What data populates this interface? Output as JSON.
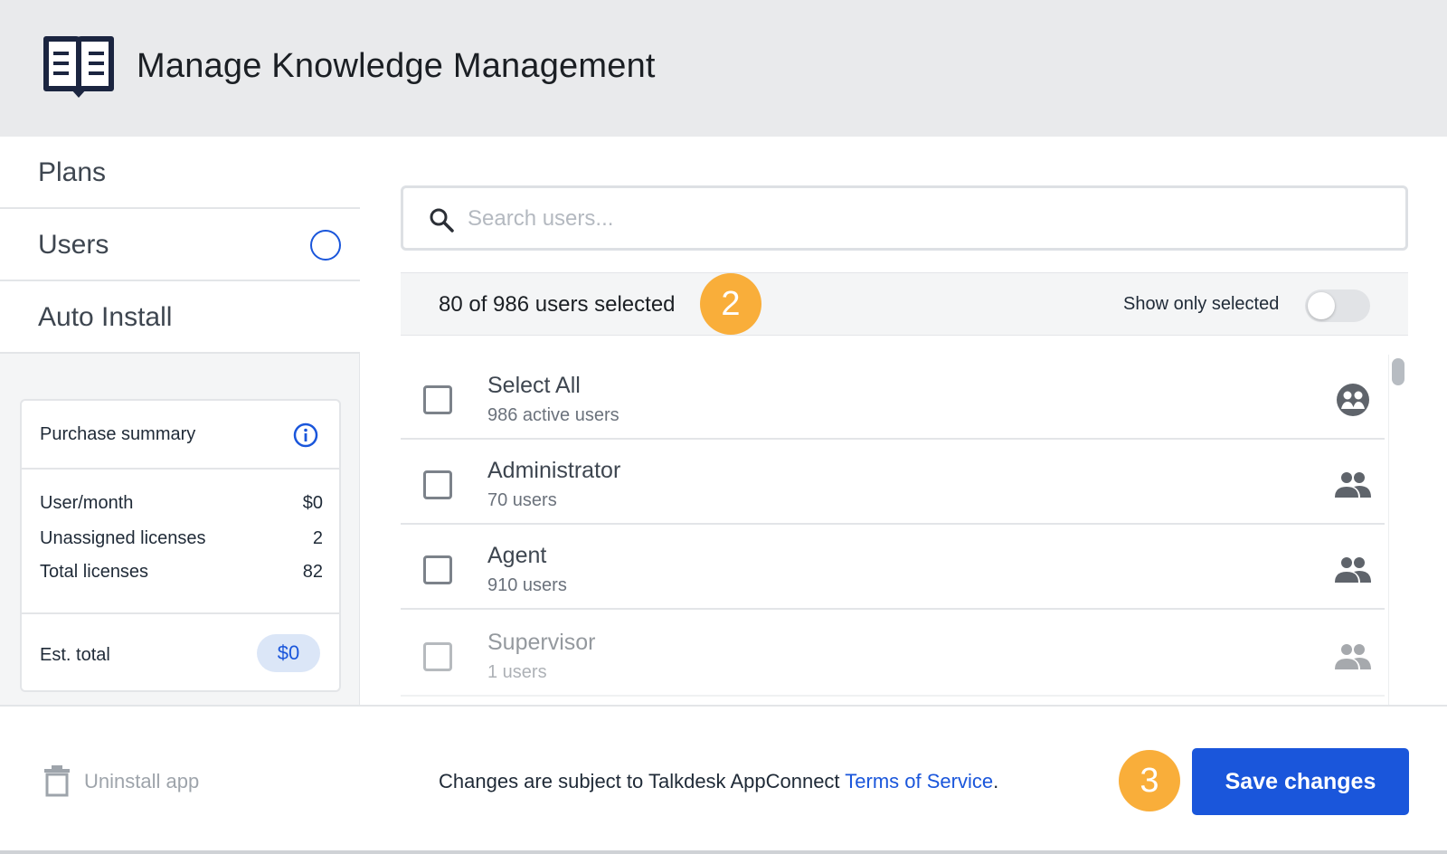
{
  "app": {
    "title": "Manage Knowledge Management",
    "icon": "book-icon"
  },
  "sidebar": {
    "items": [
      {
        "label": "Plans"
      },
      {
        "label": "Users",
        "indicator": "circle-icon"
      },
      {
        "label": "Auto Install"
      }
    ]
  },
  "purchase_summary": {
    "title": "Purchase summary",
    "rows": [
      {
        "label": "User/month",
        "value": "$0"
      },
      {
        "label": "Unassigned licenses",
        "value": "2"
      },
      {
        "label": "Total licenses",
        "value": "82"
      }
    ],
    "est_total_label": "Est. total",
    "est_total_value": "$0"
  },
  "search": {
    "placeholder": "Search users...",
    "value": ""
  },
  "selection": {
    "count_bold": "80",
    "count_rest": " of 986 users selected",
    "show_only_selected_label": "Show only selected",
    "show_only_selected": false
  },
  "badges": {
    "step2": "2",
    "step3": "3",
    "color": "#f9ae3a"
  },
  "list": [
    {
      "name": "Select All",
      "sub": "986 active users",
      "icon": "group-circle-icon",
      "checked": false
    },
    {
      "name": "Administrator",
      "sub": "70 users",
      "icon": "people-icon",
      "checked": false
    },
    {
      "name": "Agent",
      "sub": "910 users",
      "icon": "people-icon",
      "checked": false
    },
    {
      "name": "Supervisor",
      "sub": "1 users",
      "icon": "people-icon",
      "checked": false
    }
  ],
  "footer": {
    "uninstall_label": "Uninstall app",
    "terms_prefix": "Changes are subject to Talkdesk AppConnect ",
    "terms_link": "Terms of Service",
    "terms_suffix": ".",
    "save_label": "Save changes"
  },
  "colors": {
    "accent": "#1a56db",
    "header_bg": "#e9eaec"
  }
}
